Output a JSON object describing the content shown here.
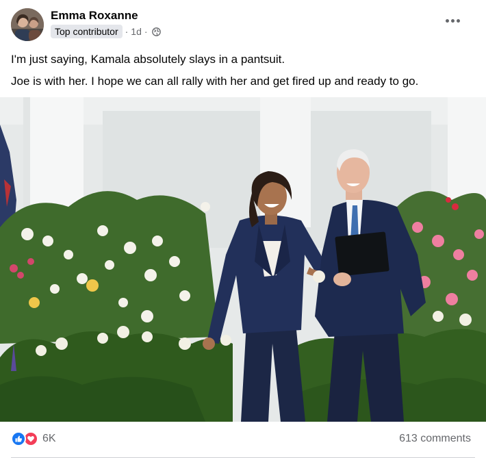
{
  "post": {
    "author": "Emma Roxanne",
    "badge": "Top contributor",
    "time": "1d",
    "separator": "·",
    "text_lines": [
      "I'm just saying, Kamala absolutely slays in a pantsuit.",
      "Joe is with her. I hope we can all rally with her and get fired up and ready to go."
    ]
  },
  "footer": {
    "reaction_count": "6K",
    "comments": "613 comments"
  },
  "icons": {
    "more": "more-horizontal-icon",
    "privacy": "globe-icon",
    "like": "like-reaction-icon",
    "love": "love-reaction-icon"
  },
  "colors": {
    "like": "#1877f2",
    "love": "#f33e58",
    "badge_bg": "#e4e6eb",
    "secondary_text": "#65676b"
  }
}
